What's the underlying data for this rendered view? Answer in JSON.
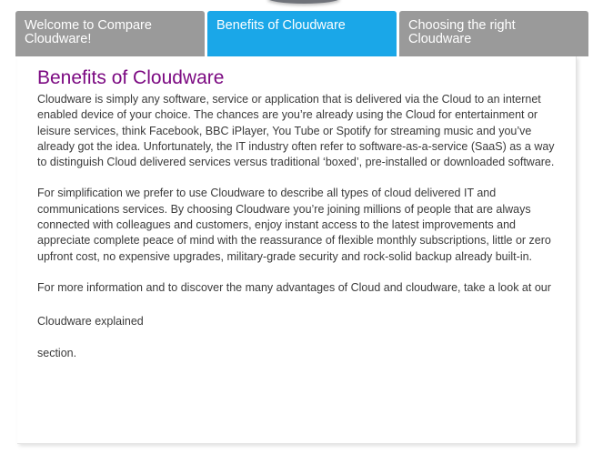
{
  "tabs": [
    {
      "label": "Welcome to Compare Cloudware!"
    },
    {
      "label": "Benefits of Cloudware"
    },
    {
      "label": "Choosing the right Cloudware"
    }
  ],
  "panel": {
    "heading": "Benefits of Cloudware",
    "paragraphs": [
      "Cloudware is simply any software, service or application that is delivered via the Cloud to an internet enabled device of your choice. The chances are you’re already using the Cloud for entertainment or leisure services, think Facebook, BBC iPlayer, You Tube or Spotify for streaming music and you’ve already got the idea. Unfortunately, the IT industry often refer to software-as-a-service (SaaS) as a way to distinguish Cloud delivered services versus traditional ‘boxed’, pre-installed or downloaded software.",
      "For simplification we prefer to use Cloudware to describe all types of cloud delivered IT and communications services. By choosing Cloudware you’re joining millions of people that are always connected with colleagues and customers, enjoy instant access to the latest improvements and appreciate complete peace of mind with the reassurance of flexible monthly subscriptions, little or zero upfront cost, no expensive upgrades, military-grade security and rock-solid backup already built-in.",
      "For more information and to discover the many advantages of Cloud and cloudware, take a look at our",
      "Cloudware explained",
      "section."
    ]
  },
  "colors": {
    "tab_inactive": "#9a9a9a",
    "tab_active": "#1aa7e8",
    "heading": "#7c0a82",
    "body_text": "#3a3a3a"
  }
}
